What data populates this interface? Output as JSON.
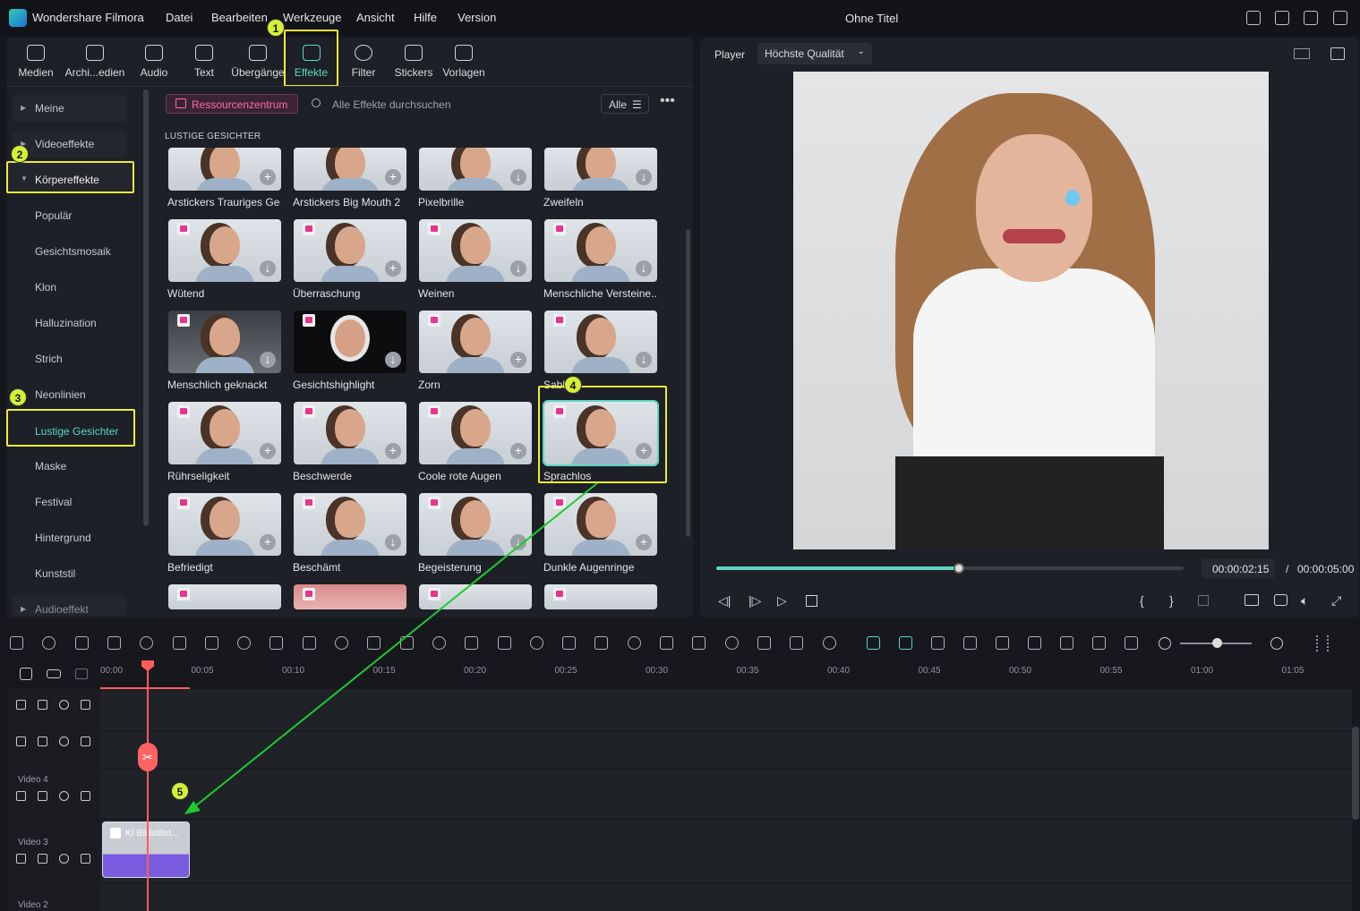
{
  "app": {
    "name": "Wondershare Filmora",
    "doc_title": "Ohne Titel"
  },
  "menu": [
    "Datei",
    "Bearbeiten",
    "Werkzeuge",
    "Ansicht",
    "Hilfe",
    "Version"
  ],
  "toolbar": [
    {
      "label": "Medien",
      "icon": "media-icon"
    },
    {
      "label": "Archi...edien",
      "icon": "archive-icon"
    },
    {
      "label": "Audio",
      "icon": "music-icon"
    },
    {
      "label": "Text",
      "icon": "text-icon"
    },
    {
      "label": "Übergänge",
      "icon": "transition-icon"
    },
    {
      "label": "Effekte",
      "icon": "effects-icon",
      "active": true
    },
    {
      "label": "Filter",
      "icon": "filter-icon"
    },
    {
      "label": "Stickers",
      "icon": "sticker-icon"
    },
    {
      "label": "Vorlagen",
      "icon": "template-icon"
    }
  ],
  "categories": [
    "Meine",
    "Videoeffekte",
    "Körpereffekte",
    "Populär",
    "Gesichtsmosaik",
    "Klon",
    "Halluzination",
    "Strich",
    "Neonlinien",
    "Lustige Gesichter",
    "Maske",
    "Festival",
    "Hintergrund",
    "Kunststil",
    "Audioeffekt"
  ],
  "resources_button": "Ressourcenzentrum",
  "search_placeholder": "Alle Effekte durchsuchen",
  "filter_label": "Alle",
  "section_title": "LUSTIGE GESICHTER",
  "effects": [
    "Arstickers Trauriges Ge...",
    "Arstickers Big Mouth 2",
    "Pixelbrille",
    "Zweifeln",
    "Wütend",
    "Überraschung",
    "Weinen",
    "Menschliche Versteine...",
    "Menschlich geknackt",
    "Gesichtshighlight",
    "Zorn",
    "Sabber",
    "Rührseligkeit",
    "Beschwerde",
    "Coole rote Augen",
    "Sprachlos",
    "Befriedigt",
    "Beschämt",
    "Begeisterung",
    "Dunkle Augenringe"
  ],
  "badges": [
    "1",
    "2",
    "3",
    "4",
    "5"
  ],
  "player": {
    "label": "Player",
    "quality": "Höchste Qualität",
    "current": "00:00:02:15",
    "separator": "/",
    "total": "00:00:05:00",
    "progress": 0.52
  },
  "ruler": [
    "00:00",
    "00:05",
    "00:10",
    "00:15",
    "00:20",
    "00:25",
    "00:30",
    "00:35",
    "00:40",
    "00:45",
    "00:50",
    "00:55",
    "01:00",
    "01:05"
  ],
  "tracks": [
    "Video 4",
    "Video 3",
    "Video 2"
  ],
  "clip_label": "KI Bildstilist...",
  "colors": {
    "accent": "#5fd6c3",
    "highlight": "#ecec3a",
    "arrow": "#1ecb2e",
    "playhead": "#ff5d5d",
    "clip": "#7a5ce0"
  }
}
